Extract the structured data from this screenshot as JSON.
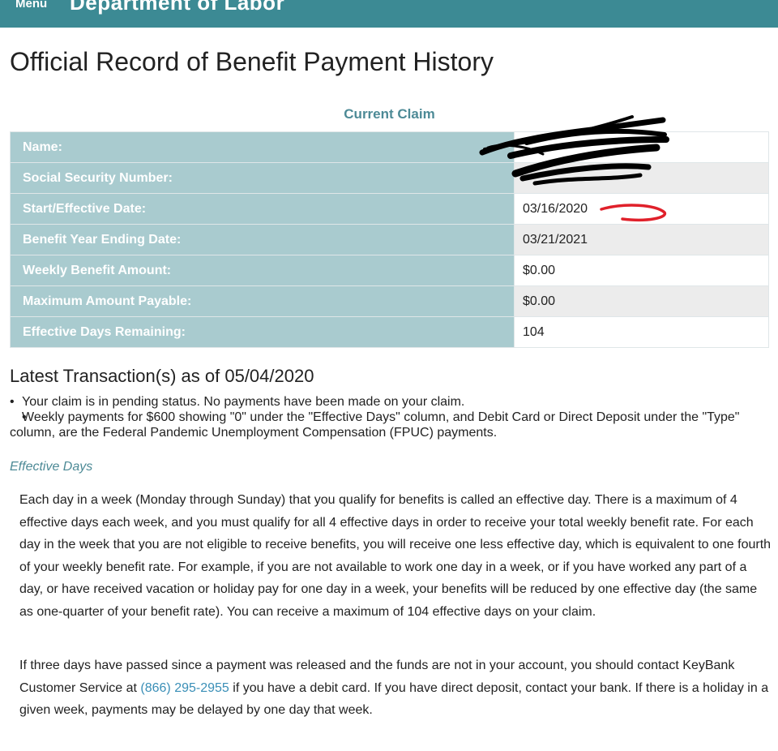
{
  "header": {
    "menu_label": "Menu",
    "department": "Department of Labor"
  },
  "page_title": "Official Record of Benefit Payment History",
  "current_claim": {
    "caption": "Current Claim",
    "rows": [
      {
        "label": "Name:",
        "value": ""
      },
      {
        "label": "Social Security Number:",
        "value": ""
      },
      {
        "label": "Start/Effective Date:",
        "value": "03/16/2020"
      },
      {
        "label": "Benefit Year Ending Date:",
        "value": "03/21/2021"
      },
      {
        "label": "Weekly Benefit Amount:",
        "value": "$0.00"
      },
      {
        "label": "Maximum Amount Payable:",
        "value": "$0.00"
      },
      {
        "label": "Effective Days Remaining:",
        "value": "104"
      }
    ]
  },
  "latest": {
    "heading": "Latest Transaction(s) as of 05/04/2020",
    "notes": [
      "Your claim is in pending status. No payments have been made on your claim.",
      "Weekly payments for $600 showing \"0\" under the \"Effective Days\" column, and Debit Card or Direct Deposit under the \"Type\" column, are the Federal Pandemic Unemployment Compensation (FPUC) payments."
    ]
  },
  "effective_days": {
    "heading": "Effective Days",
    "paragraph1": "Each day in a week (Monday through Sunday) that you qualify for benefits is called an effective day. There is a maximum of 4 effective days each week, and you must qualify for all 4 effective days in order to receive your total weekly benefit rate. For each day in the week that you are not eligible to receive benefits, you will receive one less effective day, which is equivalent to one fourth of your weekly benefit rate. For example, if you are not available to work one day in a week, or if you have worked any part of a day, or have received vacation or holiday pay for one day in a week, your benefits will be reduced by one effective day (the same as one-quarter of your benefit rate). You can receive a maximum of 104 effective days on your claim.",
    "paragraph2_before": "If three days have passed since a payment was released and the funds are not in your account, you should contact KeyBank Customer Service at ",
    "phone": "(866) 295-2955",
    "paragraph2_after": " if you have a debit card. If you have direct deposit, contact your bank. If there is a holiday in a given week, payments may be delayed by one day that week."
  },
  "colors": {
    "topbar": "#3c8a94",
    "label_cell": "#a9cbcf",
    "accent_text": "#4d8a96",
    "link": "#3a8fb7",
    "annotation_red": "#e0202a"
  }
}
